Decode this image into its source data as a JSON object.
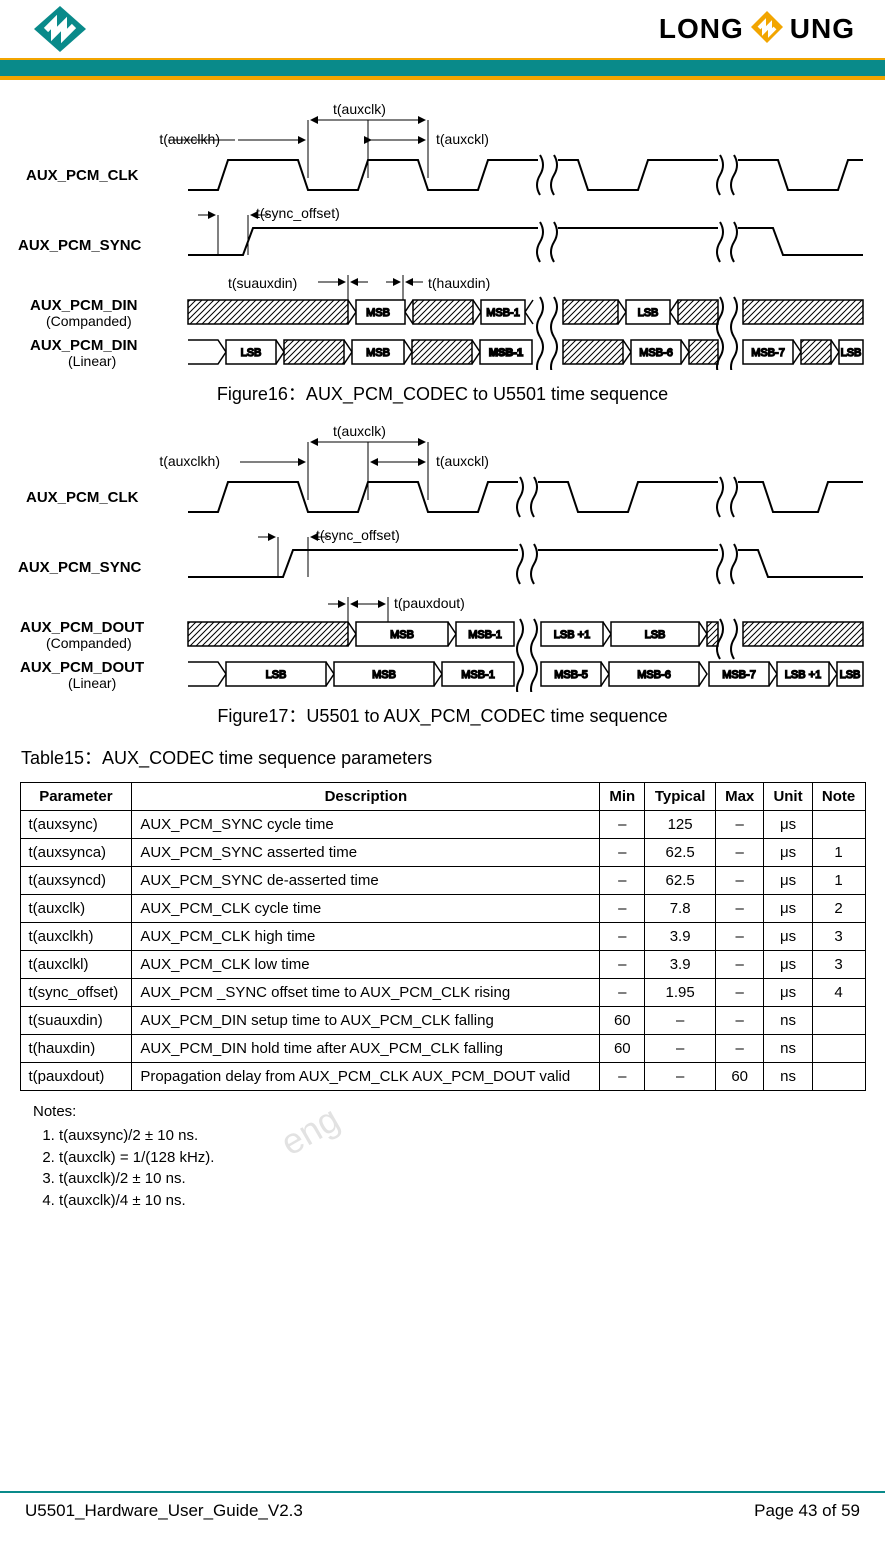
{
  "brand": {
    "left": "LONG",
    "right": "UNG"
  },
  "figures": {
    "fig16_caption": "Figure16：AUX_PCM_CODEC to U5501 time sequence",
    "fig17_caption": "Figure17：U5501 to AUX_PCM_CODEC time sequence"
  },
  "diagram1": {
    "signals": {
      "clk": "AUX_PCM_CLK",
      "sync": "AUX_PCM_SYNC",
      "din": "AUX_PCM_DIN",
      "din_sub_c": "(Companded)",
      "din_sub_l": "(Linear)"
    },
    "labels": {
      "t_auxclk": "t(auxclk)",
      "t_auxclkh": "t(auxclkh)",
      "t_auxckl": "t(auxckl)",
      "t_sync_offset": "t(sync_offset)",
      "t_suauxdin": "t(suauxdin)",
      "t_hauxdin": "t(hauxdin)"
    },
    "bits_companded": [
      "MSB",
      "MSB-1",
      "LSB"
    ],
    "bits_linear": [
      "LSB",
      "MSB",
      "MSB-1",
      "MSB-6",
      "MSB-7",
      "LSB"
    ]
  },
  "diagram2": {
    "signals": {
      "clk": "AUX_PCM_CLK",
      "sync": "AUX_PCM_SYNC",
      "dout": "AUX_PCM_DOUT",
      "dout_sub_c": "(Companded)",
      "dout_sub_l": "(Linear)"
    },
    "labels": {
      "t_auxclk": "t(auxclk)",
      "t_auxclkh": "t(auxclkh)",
      "t_auxckl": "t(auxckl)",
      "t_sync_offset": "t(sync_offset)",
      "t_pauxdout": "t(pauxdout)"
    },
    "bits_companded": [
      "MSB",
      "MSB-1",
      "LSB +1",
      "LSB"
    ],
    "bits_linear": [
      "LSB",
      "MSB",
      "MSB-1",
      "MSB-5",
      "MSB-6",
      "MSB-7",
      "LSB +1",
      "LSB"
    ]
  },
  "table_title": "Table15：AUX_CODEC time sequence parameters",
  "table": {
    "headers": [
      "Parameter",
      "Description",
      "Min",
      "Typical",
      "Max",
      "Unit",
      "Note"
    ],
    "rows": [
      {
        "param": "t(auxsync)",
        "desc": "AUX_PCM_SYNC cycle time",
        "min": "–",
        "typ": "125",
        "max": "–",
        "unit": "μs",
        "note": ""
      },
      {
        "param": "t(auxsynca)",
        "desc": "AUX_PCM_SYNC asserted time",
        "min": "–",
        "typ": "62.5",
        "max": "–",
        "unit": "μs",
        "note": "1"
      },
      {
        "param": "t(auxsyncd)",
        "desc": "AUX_PCM_SYNC de-asserted time",
        "min": "–",
        "typ": "62.5",
        "max": "–",
        "unit": "μs",
        "note": "1"
      },
      {
        "param": "t(auxclk)",
        "desc": "AUX_PCM_CLK cycle time",
        "min": "–",
        "typ": "7.8",
        "max": "–",
        "unit": "μs",
        "note": "2"
      },
      {
        "param": "t(auxclkh)",
        "desc": "AUX_PCM_CLK high time",
        "min": "–",
        "typ": "3.9",
        "max": "–",
        "unit": "μs",
        "note": "3"
      },
      {
        "param": "t(auxclkl)",
        "desc": "AUX_PCM_CLK low time",
        "min": "–",
        "typ": "3.9",
        "max": "–",
        "unit": "μs",
        "note": "3"
      },
      {
        "param": "t(sync_offset)",
        "desc": "AUX_PCM _SYNC offset time to AUX_PCM_CLK rising",
        "min": "–",
        "typ": "1.95",
        "max": "–",
        "unit": "μs",
        "note": "4"
      },
      {
        "param": "t(suauxdin)",
        "desc": "AUX_PCM_DIN setup time to AUX_PCM_CLK falling",
        "min": "60",
        "typ": "–",
        "max": "–",
        "unit": "ns",
        "note": ""
      },
      {
        "param": "t(hauxdin)",
        "desc": "AUX_PCM_DIN hold time after AUX_PCM_CLK falling",
        "min": "60",
        "typ": "–",
        "max": "–",
        "unit": "ns",
        "note": ""
      },
      {
        "param": "t(pauxdout)",
        "desc": "Propagation delay from AUX_PCM_CLK AUX_PCM_DOUT valid",
        "min": "–",
        "typ": "–",
        "max": "60",
        "unit": "ns",
        "note": ""
      }
    ]
  },
  "notes": {
    "title": "Notes:",
    "items": [
      "t(auxsync)/2 ± 10 ns.",
      "t(auxclk) = 1/(128 kHz).",
      "t(auxclk)/2 ± 10 ns.",
      "t(auxclk)/4 ± 10 ns."
    ]
  },
  "footer": {
    "doc": "U5501_Hardware_User_Guide_V2.3",
    "page": "Page 43 of 59"
  }
}
